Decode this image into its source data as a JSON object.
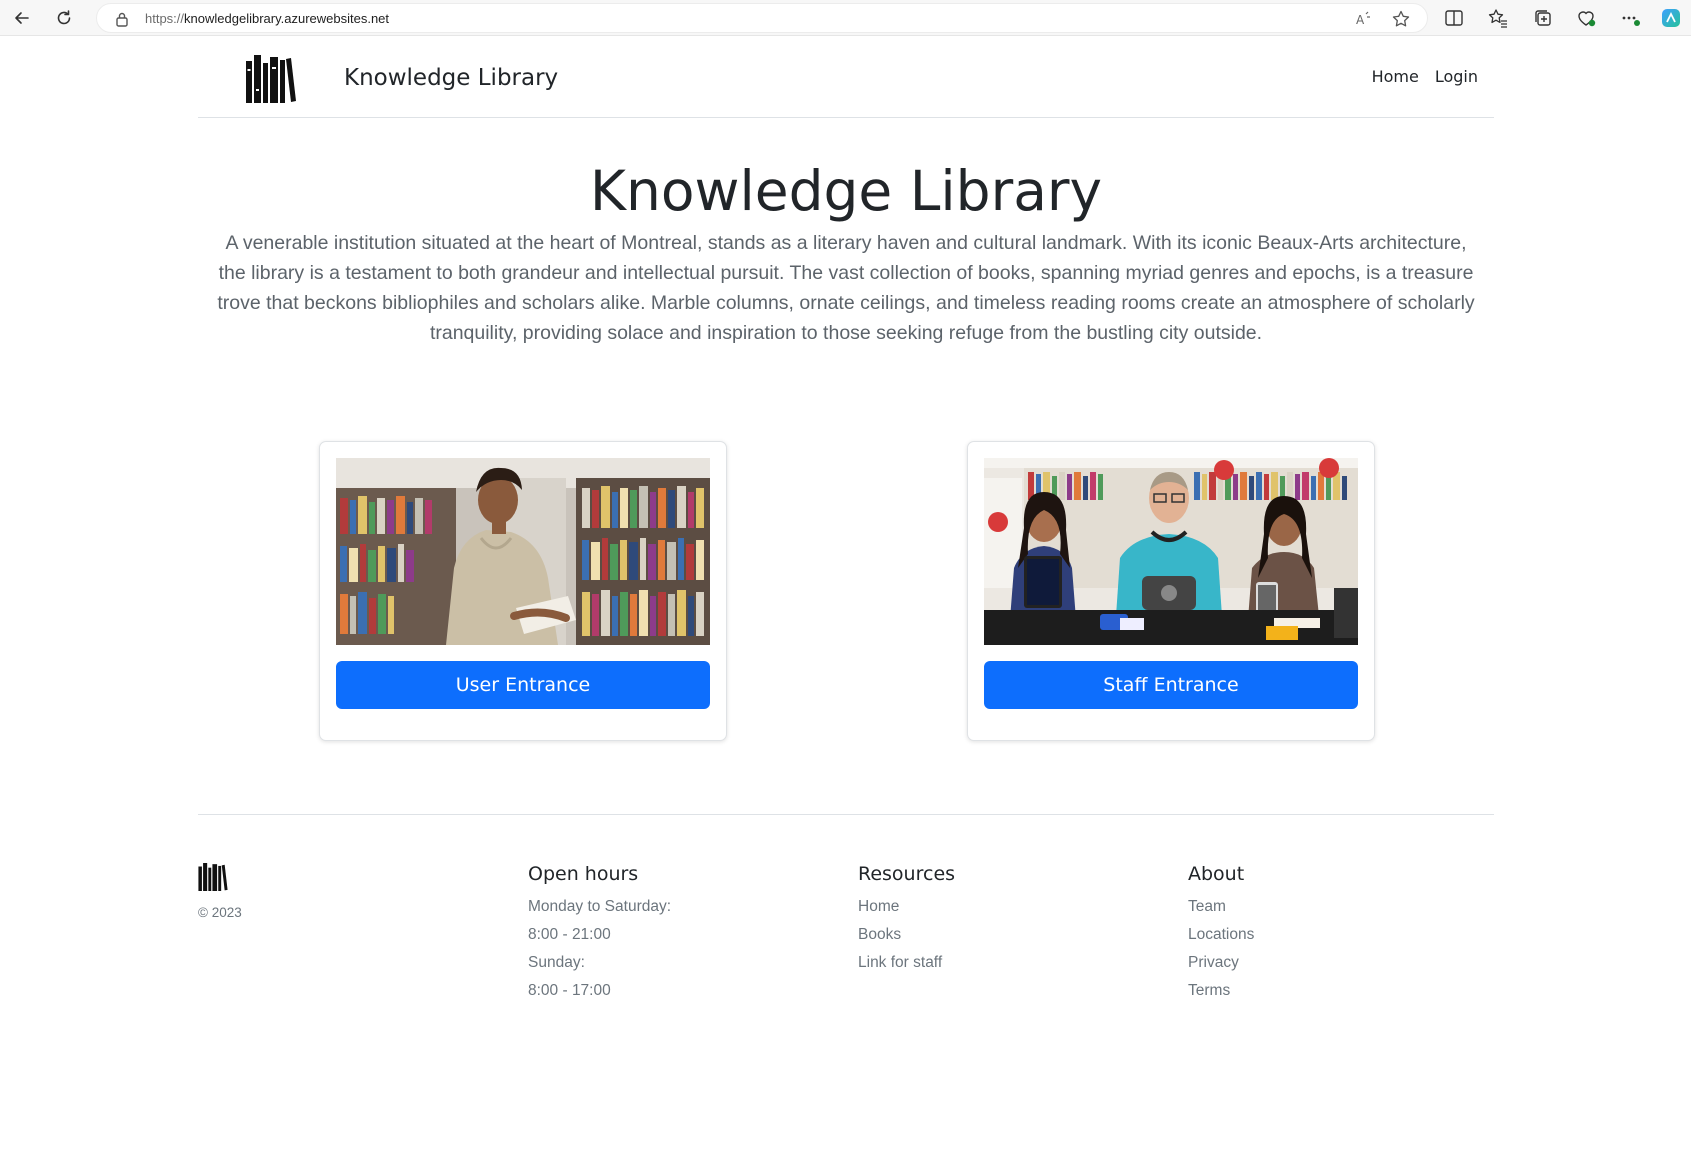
{
  "browser": {
    "url_protocol": "https://",
    "url_host": "knowledgelibrary.azurewebsites.net"
  },
  "header": {
    "brand": "Knowledge Library",
    "nav": [
      {
        "label": "Home"
      },
      {
        "label": "Login"
      }
    ]
  },
  "hero": {
    "title": "Knowledge Library",
    "description": "A venerable institution situated at the heart of Montreal, stands as a literary haven and cultural landmark. With its iconic Beaux-Arts architecture, the library is a testament to both grandeur and intellectual pursuit. The vast collection of books, spanning myriad genres and epochs, is a treasure trove that beckons bibliophiles and scholars alike. Marble columns, ornate ceilings, and timeless reading rooms create an atmosphere of scholarly tranquility, providing solace and inspiration to those seeking refuge from the bustling city outside."
  },
  "cards": {
    "user_button": "User Entrance",
    "staff_button": "Staff Entrance"
  },
  "footer": {
    "copyright": "© 2023",
    "hours": {
      "title": "Open hours",
      "items": [
        "Monday to Saturday:",
        "8:00 - 21:00",
        "Sunday:",
        "8:00 - 17:00"
      ]
    },
    "resources": {
      "title": "Resources",
      "items": [
        "Home",
        "Books",
        "Link for staff"
      ]
    },
    "about": {
      "title": "About",
      "items": [
        "Team",
        "Locations",
        "Privacy",
        "Terms"
      ]
    }
  },
  "colors": {
    "primary_button": "#0d6efd",
    "text": "#212529",
    "muted": "#6c757d"
  },
  "icons": [
    "back-arrow-icon",
    "refresh-icon",
    "lock-icon",
    "read-aloud-icon",
    "favorite-star-icon",
    "split-screen-icon",
    "favorites-icon",
    "collections-icon",
    "browser-essentials-icon",
    "more-icon",
    "copilot-icon",
    "library-logo-icon"
  ]
}
